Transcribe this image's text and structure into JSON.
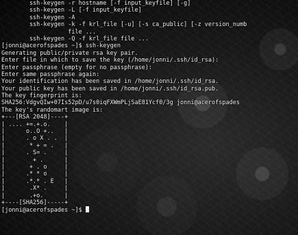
{
  "terminal": {
    "lines": [
      "        ssh-keygen -r hostname [-f input_keyfile] [-g]",
      "        ssh-keygen -L [-f input_keyfile]",
      "        ssh-keygen -A",
      "        ssh-keygen -k -f krl_file [-u] [-s ca_public] [-z version_numb",
      "                   file ...",
      "        ssh-keygen -Q -f krl_file file ...",
      "[jonni@acerofspades ~]$ ssh-keygen",
      "Generating public/private rsa key pair.",
      "Enter file in which to save the key (/home/jonni/.ssh/id_rsa):",
      "Enter passphrase (empty for no passphrase):",
      "Enter same passphrase again:",
      "Your identification has been saved in /home/jonni/.ssh/id_rsa.",
      "Your public key has been saved in /home/jonni/.ssh/id_rsa.pub.",
      "The key fingerprint is:",
      "SHA256:VdgvQIw+07Is52pD/u7s0iqFXWmPLjSaE81Ycf0/3g jonni@acerofspades",
      "The key's randomart image is:",
      "+---[RSA 2048]----+",
      "| .... +=.+.o.    |",
      "|      o..O +..   |",
      "|      . o X . .  |",
      "|       * + = .   |",
      "|      . S= .     |",
      "|        + .      |",
      "|       + . o     |",
      "|      .* * o     |",
      "|      .*.* . E   |",
      "|       .X* .     |",
      "|       .+o.      |",
      "+----[SHA256]-----+",
      "[jonni@acerofspades ~]$ "
    ]
  }
}
